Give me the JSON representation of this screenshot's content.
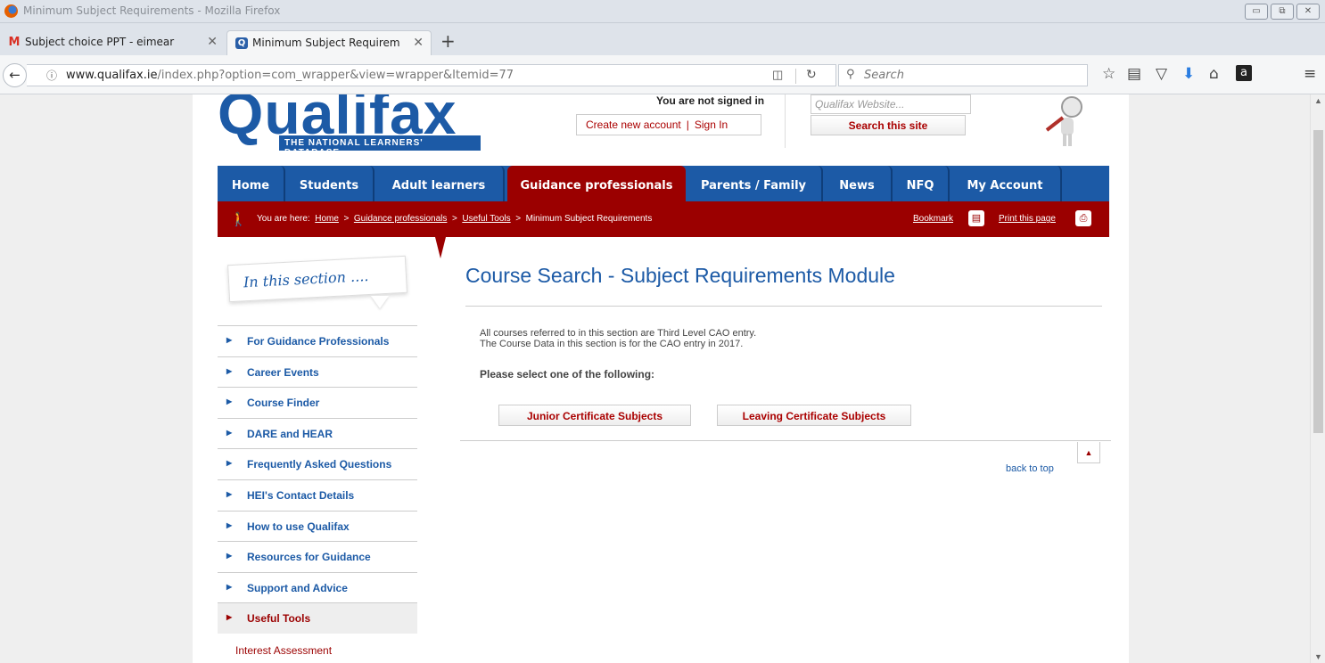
{
  "window": {
    "title": "Minimum Subject Requirements - Mozilla Firefox",
    "controls": [
      "▭",
      "⧉",
      "✕"
    ]
  },
  "tabs": [
    {
      "label": "Subject choice PPT - eimear",
      "icon": "gmail-icon",
      "close": "✕"
    },
    {
      "label": "Minimum Subject Requirem",
      "icon": "qualifax-favicon",
      "close": "✕"
    }
  ],
  "newtab": "+",
  "navbar": {
    "url_domain": "www.qualifax.ie",
    "url_path": "/index.php?option=com_wrapper&view=wrapper&Itemid=77",
    "search_placeholder": "Search"
  },
  "header": {
    "logo": "Qualifax",
    "tagline": "THE NATIONAL LEARNERS' DATABASE",
    "signed_status": "You are not signed in",
    "create_account": "Create new account",
    "sign_in": "Sign In",
    "site_search_placeholder": "Qualifax Website...",
    "site_search_button": "Search this site"
  },
  "mainnav": [
    {
      "label": "Home"
    },
    {
      "label": "Students"
    },
    {
      "label": "Adult learners"
    },
    {
      "label": "Guidance professionals"
    },
    {
      "label": "Parents / Family"
    },
    {
      "label": "News"
    },
    {
      "label": "NFQ"
    },
    {
      "label": "My Account"
    }
  ],
  "breadcrumb": {
    "prefix": "You are here:",
    "items": [
      "Home",
      "Guidance professionals",
      "Useful Tools"
    ],
    "current": "Minimum Subject Requirements",
    "bookmark": "Bookmark",
    "print": "Print this page"
  },
  "sidebar": {
    "heading": "In this section ....",
    "items": [
      "For Guidance Professionals",
      "Career Events",
      "Course Finder",
      "DARE and HEAR",
      "Frequently Asked Questions",
      "HEI's Contact Details",
      "How to use Qualifax",
      "Resources for Guidance",
      "Support and Advice",
      "Useful Tools"
    ],
    "active_index": 9,
    "subitems": [
      "Interest Assessment"
    ]
  },
  "content": {
    "title": "Course Search - Subject Requirements Module",
    "line1": "All courses referred to in this section are Third Level CAO entry.",
    "line2": "The Course Data in this section is for the CAO entry in 2017.",
    "prompt": "Please select one of the following:",
    "btn_junior": "Junior Certificate Subjects",
    "btn_leaving": "Leaving Certificate Subjects",
    "back_to_top": "back to top"
  },
  "colors": {
    "brand_blue": "#1c5aa6",
    "brand_red": "#9b0000"
  }
}
